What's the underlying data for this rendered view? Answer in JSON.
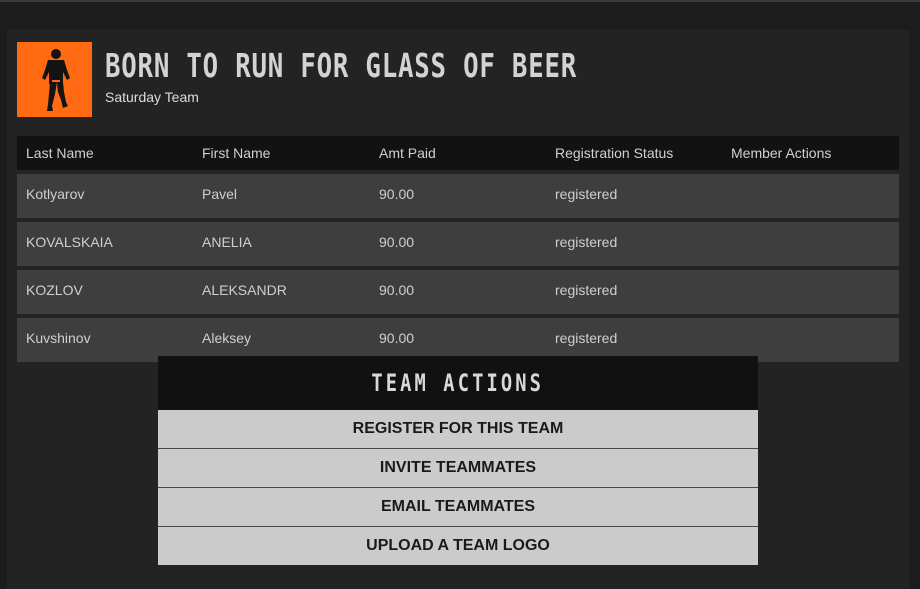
{
  "team": {
    "name": "BORN TO RUN FOR GLASS OF BEER",
    "subtitle": "Saturday Team"
  },
  "roster": {
    "columns": [
      "Last Name",
      "First Name",
      "Amt Paid",
      "Registration Status",
      "Member Actions"
    ],
    "rows": [
      {
        "last": "Kotlyarov",
        "first": "Pavel",
        "paid": "90.00",
        "status": "registered",
        "actions": ""
      },
      {
        "last": "KOVALSKAIA",
        "first": "ANELIA",
        "paid": "90.00",
        "status": "registered",
        "actions": ""
      },
      {
        "last": "KOZLOV",
        "first": "ALEKSANDR",
        "paid": "90.00",
        "status": "registered",
        "actions": ""
      },
      {
        "last": "Kuvshinov",
        "first": "Aleksey",
        "paid": "90.00",
        "status": "registered",
        "actions": ""
      }
    ]
  },
  "team_actions": {
    "title": "TEAM ACTIONS",
    "buttons": [
      "REGISTER FOR THIS TEAM",
      "INVITE TEAMMATES",
      "EMAIL TEAMMATES",
      "UPLOAD A TEAM LOGO"
    ]
  },
  "colors": {
    "background": "#1c1c1c",
    "logo_accent": "#ff6a12",
    "row_bg": "#3e3e3e",
    "button_bg": "#cbcbcb"
  }
}
